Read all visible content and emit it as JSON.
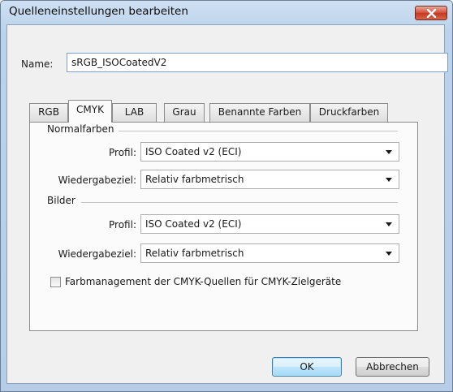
{
  "window": {
    "title": "Quelleneinstellungen bearbeiten"
  },
  "name": {
    "label": "Name:",
    "value": "sRGB_ISOCoatedV2"
  },
  "tabs": [
    {
      "label": "RGB",
      "active": false
    },
    {
      "label": "CMYK",
      "active": true
    },
    {
      "label": "LAB",
      "active": false
    },
    {
      "label": "Grau",
      "active": false
    },
    {
      "label": "Benannte Farben",
      "active": false
    },
    {
      "label": "Druckfarben",
      "active": false
    }
  ],
  "normalfarben": {
    "group_label": "Normalfarben",
    "profile_label": "Profil:",
    "profile_value": "ISO Coated v2 (ECI)",
    "intent_label": "Wiedergabeziel:",
    "intent_value": "Relativ farbmetrisch"
  },
  "bilder": {
    "group_label": "Bilder",
    "profile_label": "Profil:",
    "profile_value": "ISO Coated v2 (ECI)",
    "intent_label": "Wiedergabeziel:",
    "intent_value": "Relativ farbmetrisch"
  },
  "cmyk_option": {
    "label": "Farbmanagement der CMYK-Quellen für CMYK-Zielgeräte",
    "checked": false
  },
  "buttons": {
    "ok": "OK",
    "cancel": "Abbrechen"
  },
  "colors": {
    "titlebar": "#bad2ec",
    "close_button": "#c33a21",
    "default_button_border": "#3c7fb1"
  }
}
